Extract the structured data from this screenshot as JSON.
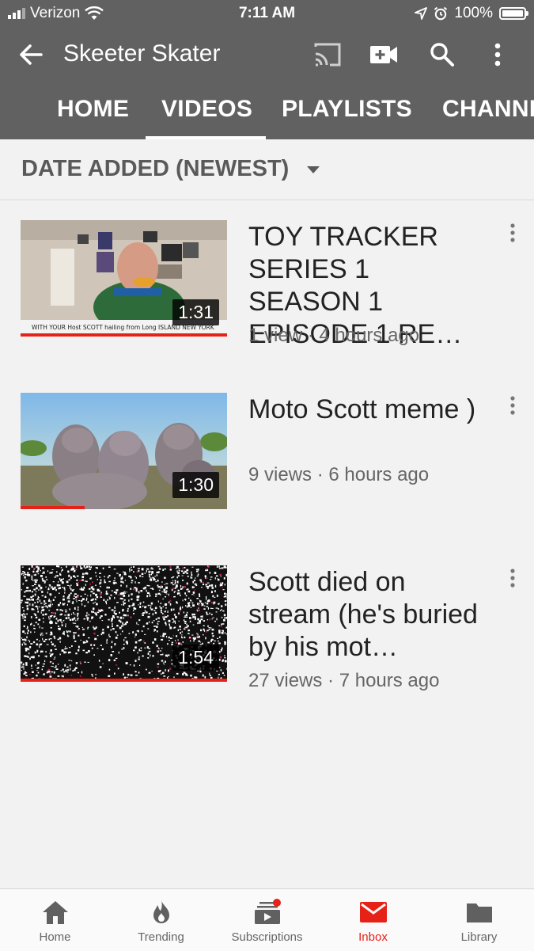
{
  "status_bar": {
    "carrier": "Verizon",
    "time": "7:11 AM",
    "battery": "100%"
  },
  "app_bar": {
    "title": "Skeeter Skater",
    "icons": [
      "back-arrow-icon",
      "cast-icon",
      "video-camera-icon",
      "search-icon",
      "more-vert-icon"
    ]
  },
  "tabs": [
    {
      "label": "HOME",
      "active": false
    },
    {
      "label": "VIDEOS",
      "active": true
    },
    {
      "label": "PLAYLISTS",
      "active": false
    },
    {
      "label": "CHANNELS",
      "active": false
    }
  ],
  "sort": {
    "label": "DATE ADDED (NEWEST)"
  },
  "videos": [
    {
      "title": "TOY TRACKER SERIES 1 SEASON 1 EPISODE 1 RE…",
      "meta": "1 view · 4 hours ago",
      "duration": "1:31",
      "watched_fraction": 1.0,
      "thumbnail_caption": "WITH YOUR Host SCOTT hailing from Long ISLAND NEW YORK"
    },
    {
      "title": "Moto Scott meme )",
      "meta": "9 views · 6 hours ago",
      "duration": "1:30",
      "watched_fraction": 0.31
    },
    {
      "title": "Scott died on stream (he's buried by his mot…",
      "meta": "27 views · 7 hours ago",
      "duration": "1:54",
      "watched_fraction": 1.0
    }
  ],
  "bottom_nav": [
    {
      "label": "Home",
      "icon": "home-icon",
      "active": false
    },
    {
      "label": "Trending",
      "icon": "flame-icon",
      "active": false
    },
    {
      "label": "Subscriptions",
      "icon": "subscriptions-icon",
      "active": false,
      "badge": true
    },
    {
      "label": "Inbox",
      "icon": "mail-icon",
      "active": true
    },
    {
      "label": "Library",
      "icon": "folder-icon",
      "active": false
    }
  ],
  "colors": {
    "header": "#616161",
    "background": "#f2f2f2",
    "accent": "#e62117",
    "meta_text": "#666666"
  }
}
